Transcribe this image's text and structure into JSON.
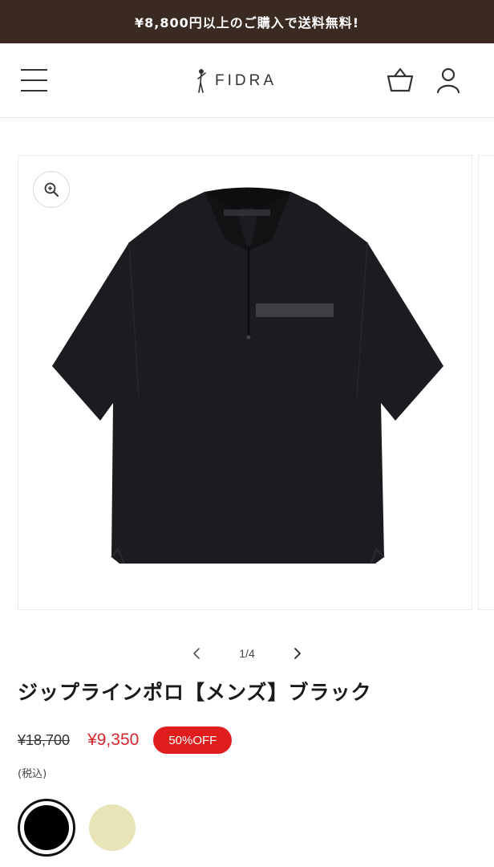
{
  "promo": {
    "text": "¥8,800円以上のご購入で送料無料!"
  },
  "header": {
    "logo_text": "FIDRA"
  },
  "gallery": {
    "current": "1/4"
  },
  "product": {
    "title": "ジップラインポロ【メンズ】ブラック",
    "price_original": "¥18,700",
    "price_sale": "¥9,350",
    "discount": "50%OFF",
    "tax_note": "(税込)"
  },
  "swatches": [
    {
      "color": "#000000",
      "selected": true
    },
    {
      "color": "#e8e4b8",
      "selected": false
    }
  ],
  "colors": {
    "promo_bg": "#3a2a22",
    "sale_red": "#d6262c",
    "badge_red": "#e01e1e"
  },
  "icons": [
    "hamburger-menu-icon",
    "golfer-logo-icon",
    "shopping-bag-icon",
    "user-icon",
    "zoom-in-icon",
    "chevron-left-icon",
    "chevron-right-icon"
  ]
}
